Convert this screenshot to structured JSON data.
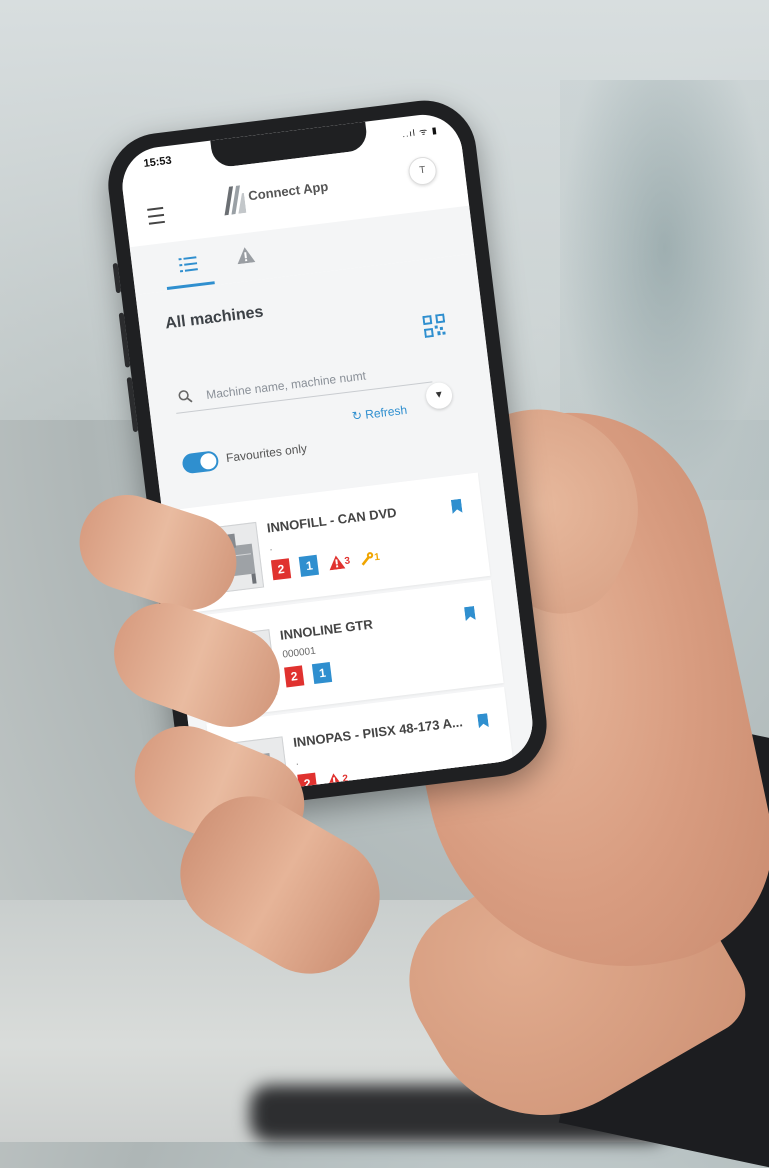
{
  "status": {
    "time": "15:53",
    "icons": "..ıl ᯤ ▮"
  },
  "header": {
    "title": "Connect App",
    "avatar_initial": "T"
  },
  "tabs": [
    {
      "name": "machine-list",
      "active": true
    },
    {
      "name": "alerts",
      "active": false
    }
  ],
  "list": {
    "title": "All machines",
    "search_placeholder": "Machine name, machine numt",
    "refresh_label": "Refresh",
    "favourites_label": "Favourites only",
    "favourites_on": true
  },
  "colors": {
    "accent": "#2f8fcf",
    "error": "#e0322f",
    "maintenance": "#f0a500"
  },
  "machines": [
    {
      "name": "INNOFILL - CAN DVD",
      "number": ".",
      "red": "2",
      "blue": "1",
      "alarm": "3",
      "tool": "1"
    },
    {
      "name": "INNOLINE GTR",
      "number": "000001",
      "red": "2",
      "blue": "1"
    },
    {
      "name": "INNOPAS - PIISX 48-173 A...",
      "number": ".",
      "red": "2",
      "alarm": "2"
    }
  ]
}
